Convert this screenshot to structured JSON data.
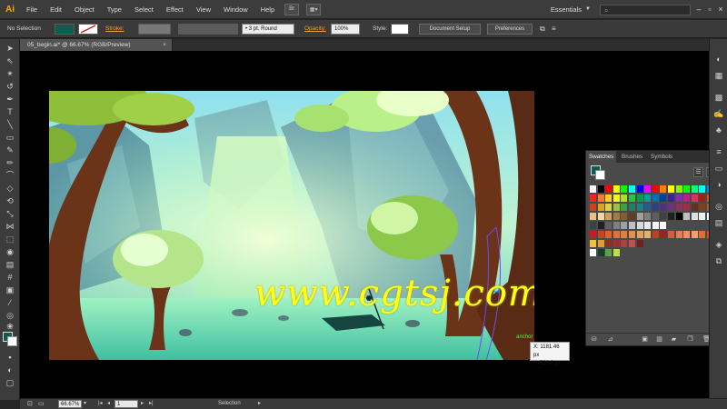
{
  "menubar": {
    "app_logo": "Ai",
    "items": [
      "File",
      "Edit",
      "Object",
      "Type",
      "Select",
      "Effect",
      "View",
      "Window",
      "Help"
    ],
    "bridge_button": "Br",
    "workspace": "Essentials",
    "search_placeholder": ""
  },
  "controlbar": {
    "selection_label": "No Selection",
    "stroke_label": "Stroke:",
    "brush_label": "3 pt. Round",
    "opacity_label": "Opacity:",
    "opacity_value": "100%",
    "style_label": "Style:",
    "document_setup": "Document Setup",
    "preferences": "Preferences",
    "fill_color": "#0e5b4f"
  },
  "document_tab": {
    "title": "05_begin.ai* @ 66.67% (RGB/Preview)",
    "close": "×"
  },
  "artwork": {
    "watermark": "www.cgtsj.com",
    "anchor_label": "anchor",
    "tooltip_x": "X: 1181.46 px",
    "tooltip_y": "Y: 536.3 px"
  },
  "swatches_panel": {
    "tabs": [
      "Swatches",
      "Brushes",
      "Symbols"
    ],
    "menu": "≡"
  },
  "statusbar": {
    "zoom": "66.67%",
    "artboard_number": "1",
    "tool_name": "Selection"
  },
  "colors": {
    "accent": "#f7a21b",
    "panel_bg": "#4a4a4a",
    "chrome_bg": "#3c3c3c"
  }
}
